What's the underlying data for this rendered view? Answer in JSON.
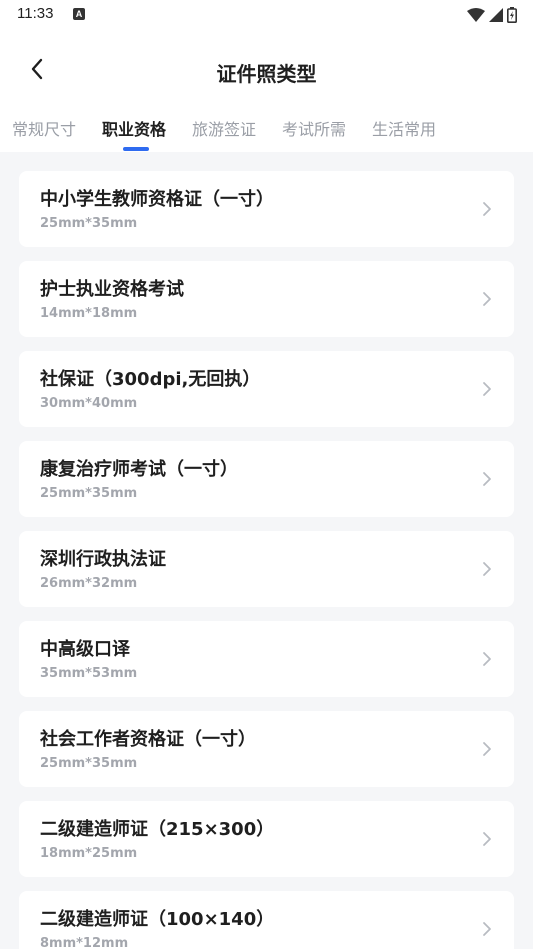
{
  "status_bar": {
    "time": "11:33",
    "app_icon_letter": "A",
    "icons": [
      "wifi-icon",
      "signal-icon",
      "battery-icon"
    ]
  },
  "header": {
    "title": "证件照类型",
    "back_icon": "chevron-left-icon"
  },
  "tabs": [
    {
      "label": "常规尺寸",
      "active": false
    },
    {
      "label": "职业资格",
      "active": true
    },
    {
      "label": "旅游签证",
      "active": false
    },
    {
      "label": "考试所需",
      "active": false
    },
    {
      "label": "生活常用",
      "active": false
    }
  ],
  "colors": {
    "accent": "#2f6bf0",
    "background": "#f5f6f8",
    "card": "#ffffff",
    "text_primary": "#1f1f1f",
    "text_secondary": "#a3a6ad",
    "tab_inactive": "#9a9ea6"
  },
  "items": [
    {
      "title": "中小学生教师资格证（一寸）",
      "size": "25mm*35mm"
    },
    {
      "title": "护士执业资格考试",
      "size": "14mm*18mm"
    },
    {
      "title": "社保证（300dpi,无回执）",
      "size": "30mm*40mm"
    },
    {
      "title": "康复治疗师考试（一寸）",
      "size": "25mm*35mm"
    },
    {
      "title": "深圳行政执法证",
      "size": "26mm*32mm"
    },
    {
      "title": "中高级口译",
      "size": "35mm*53mm"
    },
    {
      "title": "社会工作者资格证（一寸）",
      "size": "25mm*35mm"
    },
    {
      "title": "二级建造师证（215×300）",
      "size": "18mm*25mm"
    },
    {
      "title": "二级建造师证（100×140）",
      "size": "8mm*12mm"
    }
  ]
}
